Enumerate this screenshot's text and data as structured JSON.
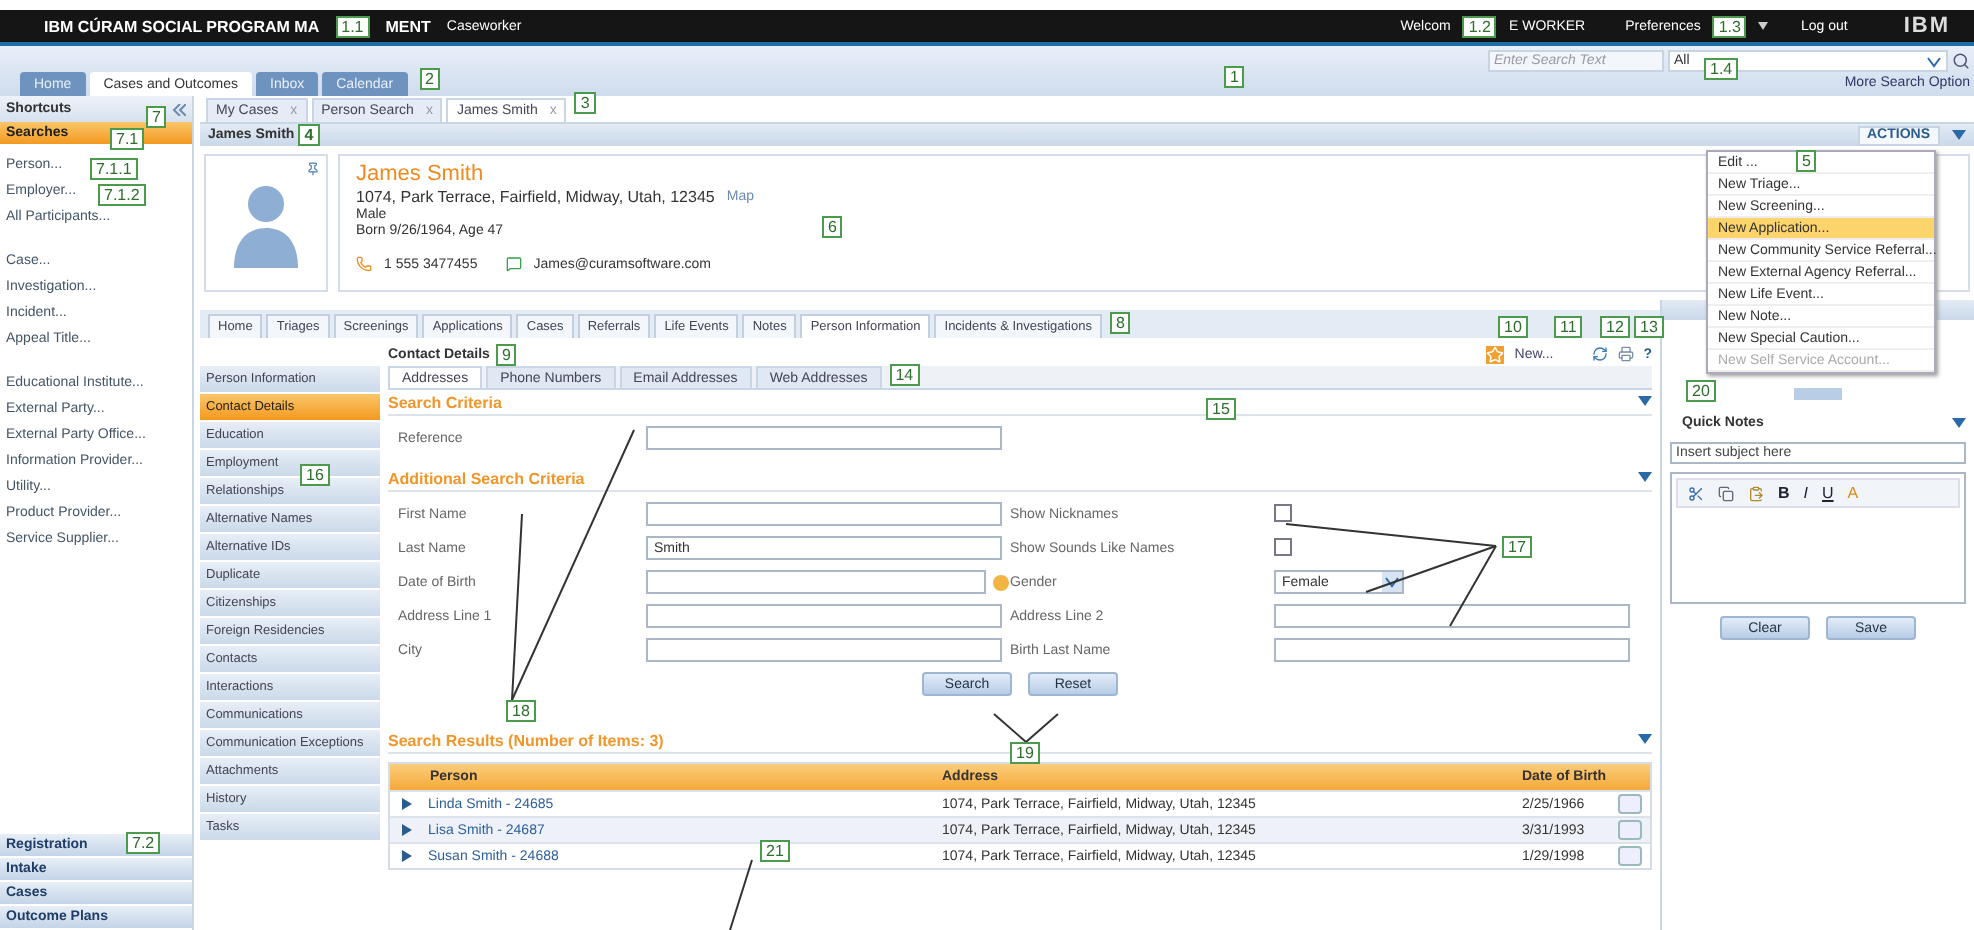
{
  "header": {
    "title_left": "IBM CÚRAM SOCIAL PROGRAM MA",
    "title_right": "MENT",
    "role": "Caseworker",
    "welcome_left": "Welcom",
    "welcome_right": "E WORKER",
    "preferences": "Preferences",
    "logout": "Log out",
    "logo": "IBM"
  },
  "search": {
    "placeholder": "Enter Search Text",
    "scope": "All",
    "more": "More Search Option"
  },
  "main_tabs": [
    {
      "label": "Home",
      "selected": false
    },
    {
      "label": "Cases and Outcomes",
      "selected": true
    },
    {
      "label": "Inbox",
      "selected": false
    },
    {
      "label": "Calendar",
      "selected": false
    }
  ],
  "shortcuts": {
    "title": "Shortcuts",
    "section": "Searches",
    "groups": [
      [
        "Person...",
        "Employer...",
        "All Participants..."
      ],
      [
        "Case...",
        "Investigation...",
        "Incident...",
        "Appeal Title..."
      ],
      [
        "Educational Institute...",
        "External Party...",
        "External Party Office...",
        "Information Provider...",
        "Utility...",
        "Product Provider...",
        "Service Supplier..."
      ]
    ],
    "collapsed_sections": [
      "Registration",
      "Intake",
      "Cases",
      "Outcome Plans"
    ]
  },
  "session_tabs": [
    {
      "label": "My Cases",
      "close": "x",
      "selected": false
    },
    {
      "label": "Person Search",
      "close": "x",
      "selected": false
    },
    {
      "label": "James Smith",
      "close": "x",
      "selected": true
    }
  ],
  "person": {
    "heading": "James Smith",
    "name": "James Smith",
    "address": "1074, Park Terrace, Fairfield, Midway, Utah, 12345",
    "map": "Map",
    "gender": "Male",
    "born": "Born 9/26/1964, Age 47",
    "phone": "1 555 3477455",
    "email": "James@curamsoftware.com"
  },
  "actions": {
    "label": "ACTIONS",
    "items": [
      {
        "label": "Edit ...",
        "highlighted": false,
        "disabled": false
      },
      {
        "label": "New Triage...",
        "highlighted": false,
        "disabled": false
      },
      {
        "label": "New Screening...",
        "highlighted": false,
        "disabled": false
      },
      {
        "label": "New Application...",
        "highlighted": true,
        "disabled": false
      },
      {
        "label": "New Community Service Referral...",
        "highlighted": false,
        "disabled": false
      },
      {
        "label": "New External Agency Referral...",
        "highlighted": false,
        "disabled": false
      },
      {
        "label": "New Life Event...",
        "highlighted": false,
        "disabled": false
      },
      {
        "label": "New Note...",
        "highlighted": false,
        "disabled": false
      },
      {
        "label": "New Special Caution...",
        "highlighted": false,
        "disabled": false
      },
      {
        "label": "New Self Service Account...",
        "highlighted": false,
        "disabled": true
      }
    ]
  },
  "page_tabs": [
    {
      "label": "Home",
      "selected": false
    },
    {
      "label": "Triages",
      "selected": false
    },
    {
      "label": "Screenings",
      "selected": false
    },
    {
      "label": "Applications",
      "selected": false
    },
    {
      "label": "Cases",
      "selected": false
    },
    {
      "label": "Referrals",
      "selected": false
    },
    {
      "label": "Life Events",
      "selected": false
    },
    {
      "label": "Notes",
      "selected": false
    },
    {
      "label": "Person Information",
      "selected": true
    },
    {
      "label": "Incidents & Investigations",
      "selected": false
    }
  ],
  "side_nav": [
    {
      "label": "Person Information",
      "selected": false
    },
    {
      "label": "Contact Details",
      "selected": true
    },
    {
      "label": "Education",
      "selected": false
    },
    {
      "label": "Employment",
      "selected": false
    },
    {
      "label": "Relationships",
      "selected": false
    },
    {
      "label": "Alternative Names",
      "selected": false
    },
    {
      "label": "Alternative IDs",
      "selected": false
    },
    {
      "label": "Duplicate",
      "selected": false
    },
    {
      "label": "Citizenships",
      "selected": false
    },
    {
      "label": "Foreign Residencies",
      "selected": false
    },
    {
      "label": "Contacts",
      "selected": false
    },
    {
      "label": "Interactions",
      "selected": false
    },
    {
      "label": "Communications",
      "selected": false
    },
    {
      "label": "Communication Exceptions",
      "selected": false
    },
    {
      "label": "Attachments",
      "selected": false
    },
    {
      "label": "History",
      "selected": false
    },
    {
      "label": "Tasks",
      "selected": false
    }
  ],
  "page_title": "Contact Details",
  "toolbar": {
    "new": "New...",
    "help": "?"
  },
  "sub_tabs": [
    {
      "label": "Addresses",
      "selected": true
    },
    {
      "label": "Phone Numbers",
      "selected": false
    },
    {
      "label": "Email Addresses",
      "selected": false
    },
    {
      "label": "Web Addresses",
      "selected": false
    }
  ],
  "search_criteria": {
    "title": "Search Criteria",
    "fields": [
      {
        "label": "Reference",
        "kind": "text"
      }
    ]
  },
  "additional_criteria": {
    "title": "Additional Search Criteria",
    "rows": [
      [
        {
          "label": "First Name",
          "kind": "text"
        },
        {
          "label": "Show Nicknames",
          "kind": "checkbox",
          "checked": false
        }
      ],
      [
        {
          "label": "Last Name",
          "kind": "text",
          "value": "Smith"
        },
        {
          "label": "Show Sounds Like Names",
          "kind": "checkbox",
          "checked": false
        }
      ],
      [
        {
          "label": "Date of Birth",
          "kind": "date"
        },
        {
          "label": "Gender",
          "kind": "select",
          "value": "Female"
        }
      ],
      [
        {
          "label": "Address Line 1",
          "kind": "text"
        },
        {
          "label": "Address Line 2",
          "kind": "text"
        }
      ],
      [
        {
          "label": "City",
          "kind": "text"
        },
        {
          "label": "Birth Last Name",
          "kind": "text"
        }
      ]
    ]
  },
  "buttons": [
    "Search",
    "Reset"
  ],
  "results": {
    "title": "Search Results (Number of Items: 3)",
    "columns": [
      "Person",
      "Address",
      "Date of Birth"
    ],
    "rows": [
      [
        "Linda Smith - 24685",
        "1074, Park Terrace, Fairfield, Midway, Utah, 12345",
        "2/25/1966"
      ],
      [
        "Lisa Smith - 24687",
        "1074, Park Terrace, Fairfield, Midway, Utah, 12345",
        "3/31/1993"
      ],
      [
        "Susan Smith - 24688",
        "1074, Park Terrace, Fairfield, Midway, Utah, 12345",
        "1/29/1998"
      ]
    ]
  },
  "quick_notes": {
    "title": "Quick Notes",
    "subject_placeholder": "Insert subject here",
    "format_buttons": [
      "B",
      "I",
      "U",
      "A"
    ],
    "buttons": [
      "Clear",
      "Save"
    ]
  },
  "callouts": [
    "1",
    "1.1",
    "1.2",
    "1.3",
    "1.4",
    "2",
    "3",
    "4",
    "5",
    "6",
    "7",
    "7.1",
    "7.1.1",
    "7.1.2",
    "7.2",
    "8",
    "9",
    "10",
    "11",
    "12",
    "13",
    "14",
    "15",
    "16",
    "17",
    "18",
    "19",
    "20",
    "21"
  ]
}
